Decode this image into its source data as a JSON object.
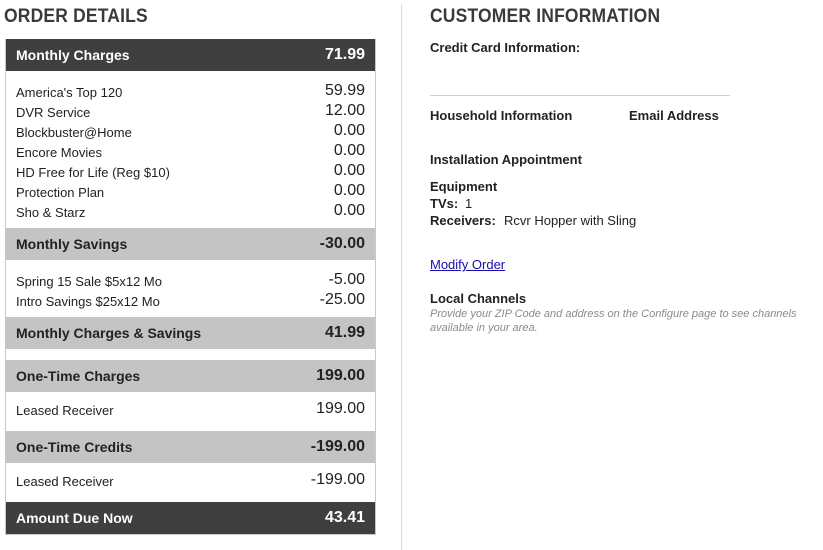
{
  "order": {
    "title": "ORDER DETAILS",
    "monthly_charges": {
      "label": "Monthly Charges",
      "amount": "71.99"
    },
    "charge_items": [
      {
        "label": "America's Top 120",
        "value": "59.99"
      },
      {
        "label": "DVR Service",
        "value": "12.00"
      },
      {
        "label": "Blockbuster@Home",
        "value": "0.00"
      },
      {
        "label": "Encore Movies",
        "value": "0.00"
      },
      {
        "label": "HD Free for Life (Reg $10)",
        "value": "0.00"
      },
      {
        "label": "Protection Plan",
        "value": "0.00"
      },
      {
        "label": "Sho & Starz",
        "value": "0.00"
      }
    ],
    "monthly_savings": {
      "label": "Monthly Savings",
      "amount": "-30.00"
    },
    "savings_items": [
      {
        "label": "Spring 15 Sale $5x12 Mo",
        "value": "-5.00"
      },
      {
        "label": "Intro Savings $25x12 Mo",
        "value": "-25.00"
      }
    ],
    "charges_and_savings": {
      "label": "Monthly Charges & Savings",
      "amount": "41.99"
    },
    "one_time_charges": {
      "label": "One-Time Charges",
      "amount": "199.00"
    },
    "one_time_items": [
      {
        "label": "Leased Receiver",
        "value": "199.00"
      }
    ],
    "one_time_credits": {
      "label": "One-Time Credits",
      "amount": "-199.00"
    },
    "credit_items": [
      {
        "label": "Leased Receiver",
        "value": "-199.00"
      }
    ],
    "amount_due": {
      "label": "Amount Due Now",
      "amount": "43.41"
    }
  },
  "customer": {
    "title": "CUSTOMER INFORMATION",
    "credit_card_label": "Credit Card Information:",
    "household_label": "Household Information",
    "email_label": "Email Address",
    "installation_label": "Installation Appointment",
    "equipment_label": "Equipment",
    "tvs_label": "TVs:",
    "tvs_value": "1",
    "receivers_label": "Receivers:",
    "receivers_value": "Rcvr Hopper with Sling",
    "modify_link": "Modify Order",
    "local_channels_label": "Local Channels",
    "local_channels_note": "Provide your ZIP Code and address on the Configure page to see channels available in your area."
  }
}
